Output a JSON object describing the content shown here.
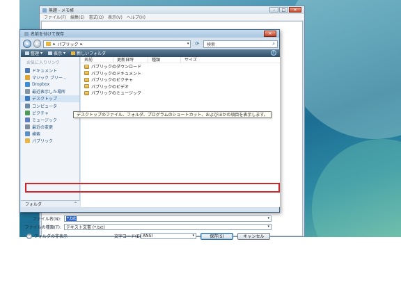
{
  "notepad": {
    "title": "無題 - メモ帳",
    "menu": [
      "ファイル(F)",
      "編集(E)",
      "書式(O)",
      "表示(V)",
      "ヘルプ(H)"
    ]
  },
  "dialog": {
    "title": "名前を付けて保存",
    "address": {
      "path": "パブリック",
      "separator": "▸"
    },
    "search_placeholder": "検索",
    "toolbar": {
      "organize": "整理",
      "views": "表示",
      "new_folder": "新しいフォルダ",
      "help": "?"
    },
    "nav": {
      "heading": "お気に入りリンク",
      "items": [
        {
          "label": "ドキュメント",
          "color": "#4a7ab8"
        },
        {
          "label": "マジック ブリー...",
          "color": "#e0a52e"
        },
        {
          "label": "Dropbox",
          "color": "#3b8ed6"
        },
        {
          "label": "最近表示した場所",
          "color": "#8794a3"
        },
        {
          "label": "デスクトップ",
          "color": "#3a78c0"
        },
        {
          "label": "コンピュータ",
          "color": "#6a8aa8"
        },
        {
          "label": "ピクチャ",
          "color": "#4f9a5b"
        },
        {
          "label": "ミュージック",
          "color": "#5e7fc4"
        },
        {
          "label": "最近の変更",
          "color": "#7d8c9c"
        },
        {
          "label": "検索",
          "color": "#5a90c8"
        },
        {
          "label": "パブリック",
          "color": "#e4b648"
        }
      ],
      "folder_label": "フォルダ",
      "selected_index": 4
    },
    "columns": [
      "名前",
      "更新日時",
      "種類",
      "サイズ"
    ],
    "files": [
      "パブリックのダウンロード",
      "パブリックのドキュメント",
      "パブリックのピクチャ",
      "パブリックのビデオ",
      "パブリックのミュージック"
    ],
    "tooltip": "デスクトップのファイル、フォルダ、プログラムのショートカット、およびほかの項目を表示します。",
    "filename_label": "ファイル名(N):",
    "filename_value": "*.txt",
    "filetype_label": "ファイルの種類(T):",
    "filetype_value": "テキスト文書 (*.txt)",
    "hide_folders": "フォルダの非表示",
    "encoding_label": "文字コード(E):",
    "encoding_value": "ANSI",
    "save_button": "保存(S)",
    "cancel_button": "キャンセル",
    "highlight_color": "#d0252a"
  }
}
